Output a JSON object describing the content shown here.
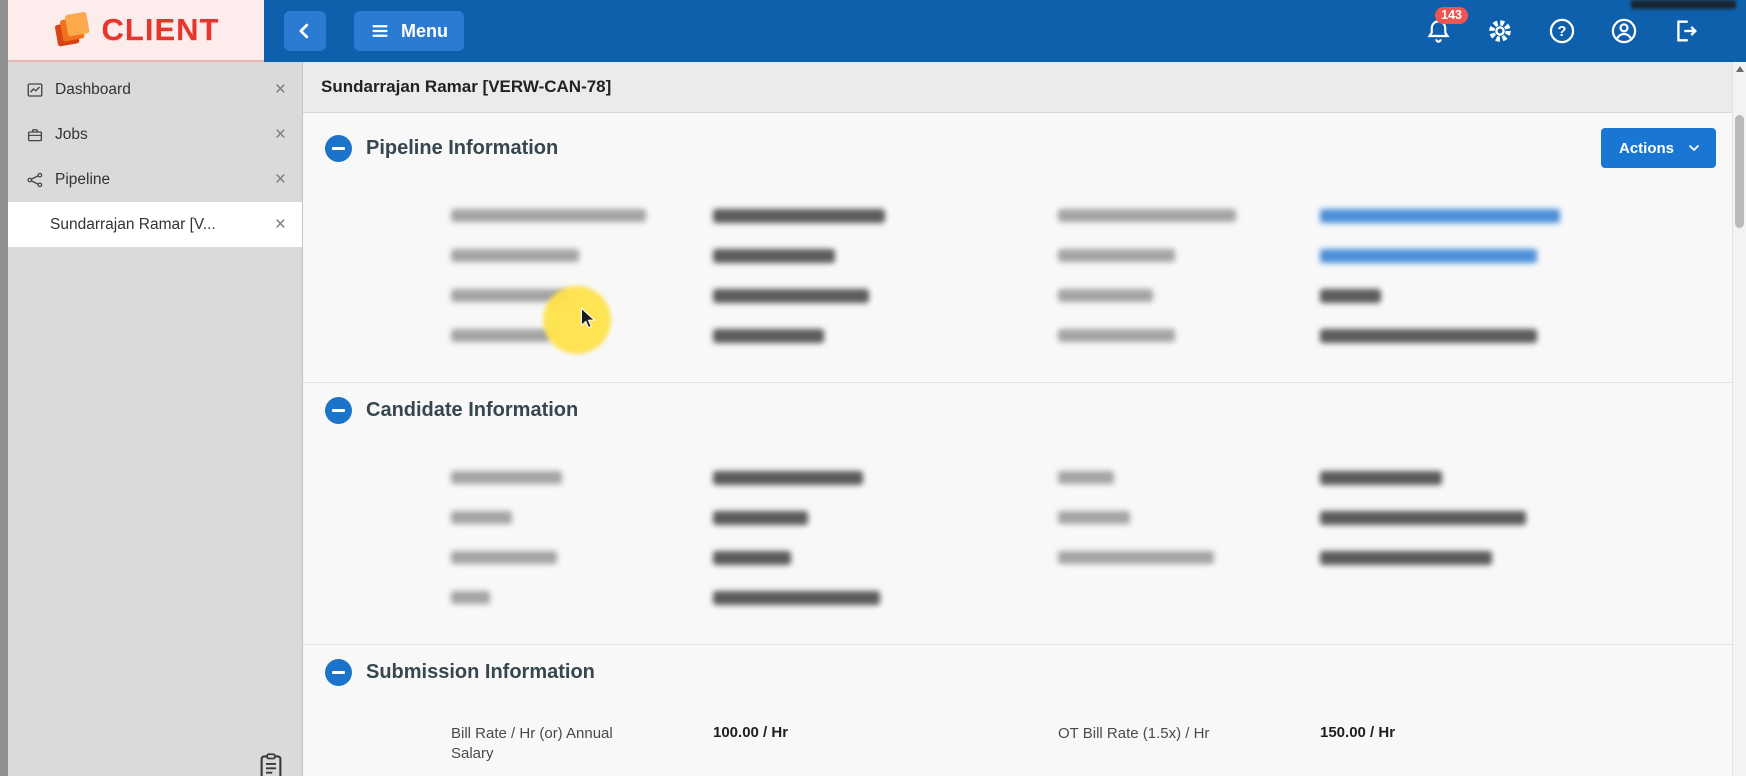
{
  "topbar": {
    "brand": "CLIENT",
    "menu_label": "Menu",
    "notification_count": "143"
  },
  "icons": {
    "close": "×",
    "help_mark": "?"
  },
  "sidebar": {
    "items": [
      {
        "label": "Dashboard"
      },
      {
        "label": "Jobs"
      },
      {
        "label": "Pipeline"
      },
      {
        "label": "Sundarrajan Ramar [V..."
      }
    ]
  },
  "main": {
    "page_title": "Sundarrajan Ramar [VERW-CAN-78]",
    "actions_label": "Actions",
    "sections": [
      {
        "title": "Pipeline Information"
      },
      {
        "title": "Candidate Information"
      },
      {
        "title": "Submission Information"
      }
    ],
    "submission_fields": [
      {
        "label": "Bill Rate / Hr (or) Annual Salary",
        "value": "100.00 / Hr"
      },
      {
        "label": "OT Bill Rate (1.5x) / Hr",
        "value": "150.00 / Hr"
      }
    ]
  },
  "colors": {
    "topbar_blue": "#0e60ac",
    "accent_blue": "#1b74ca",
    "badge_red": "#f0544f",
    "highlight_yellow": "#ffe24a"
  },
  "blurred": {
    "pipeline_rows": [
      {
        "l": 195,
        "v": 172,
        "l2": 178,
        "v2": 240,
        "link2": true
      },
      {
        "l": 128,
        "v": 122,
        "l2": 117,
        "v2": 217,
        "link2": true
      },
      {
        "l": 117,
        "v": 156,
        "l2": 95,
        "v2": 61
      },
      {
        "l": 100,
        "v": 111,
        "l2": 117,
        "v2": 217
      }
    ],
    "candidate_rows": [
      {
        "l": 111,
        "v": 150,
        "l2": 56,
        "v2": 122
      },
      {
        "l": 61,
        "v": 95,
        "l2": 72,
        "v2": 206
      },
      {
        "l": 106,
        "v": 78,
        "l2": 156,
        "v2": 172
      },
      {
        "l": 39,
        "v": 167
      }
    ]
  }
}
